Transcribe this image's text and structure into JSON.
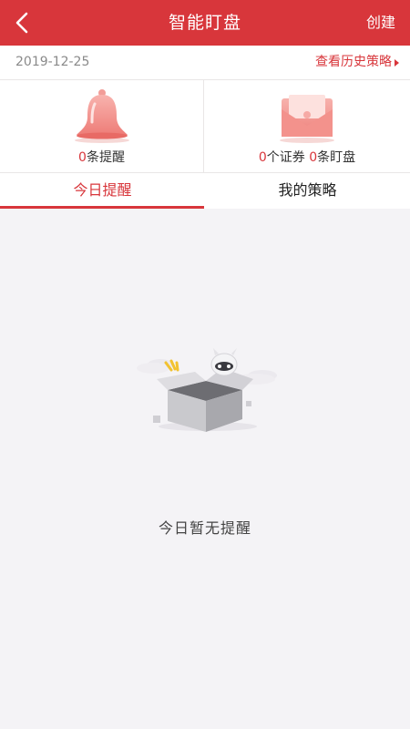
{
  "header": {
    "title": "智能盯盘",
    "create_label": "创建",
    "back_icon": "chevron-left-icon",
    "background": "#d8363b"
  },
  "datebar": {
    "date": "2019-12-25",
    "history_link": "查看历史策略"
  },
  "stats": {
    "reminders": {
      "count": "0",
      "label": "条提醒",
      "icon": "bell-icon"
    },
    "watch": {
      "securities_count": "0",
      "securities_label": "个证券",
      "watch_count": "0",
      "watch_label": "条盯盘",
      "icon": "envelope-icon"
    }
  },
  "tabs": [
    {
      "label": "今日提醒",
      "active": true
    },
    {
      "label": "我的策略",
      "active": false
    }
  ],
  "empty_state": {
    "message": "今日暂无提醒",
    "icon": "empty-box-icon"
  },
  "colors": {
    "accent": "#d8363b",
    "page_bg": "#f4f3f6"
  }
}
